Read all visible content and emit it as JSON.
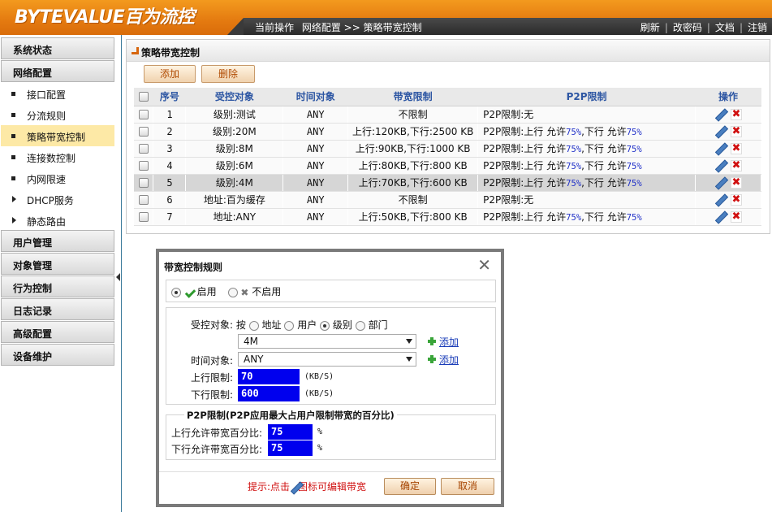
{
  "header": {
    "logo": "BYTEVALUE百为流控",
    "crumb_label": "当前操作",
    "crumb_path": "网络配置 >> 策略带宽控制",
    "links": [
      "刷新",
      "改密码",
      "文档",
      "注销"
    ]
  },
  "sidebar": {
    "groups_top": [
      "系统状态",
      "网络配置"
    ],
    "items": [
      {
        "label": "接口配置",
        "marker": "bullet"
      },
      {
        "label": "分流规则",
        "marker": "bullet"
      },
      {
        "label": "策略带宽控制",
        "marker": "bullet",
        "active": true
      },
      {
        "label": "连接数控制",
        "marker": "bullet"
      },
      {
        "label": "内网限速",
        "marker": "bullet"
      },
      {
        "label": "DHCP服务",
        "marker": "triangle"
      },
      {
        "label": "静态路由",
        "marker": "triangle"
      }
    ],
    "groups_bottom": [
      "用户管理",
      "对象管理",
      "行为控制",
      "日志记录",
      "高级配置",
      "设备维护"
    ]
  },
  "panel": {
    "title": "策略带宽控制",
    "add_label": "添加",
    "delete_label": "删除"
  },
  "table": {
    "headers": [
      "序号",
      "受控对象",
      "时间对象",
      "带宽限制",
      "P2P限制",
      "操作"
    ],
    "rows": [
      {
        "no": "1",
        "object": "级别:测试",
        "time": "ANY",
        "bw": "不限制",
        "p2p_none": "P2P限制:无"
      },
      {
        "no": "2",
        "object": "级别:20M",
        "time": "ANY",
        "bw": "上行:120KB,下行:2500 KB",
        "p2p_up": "75%",
        "p2p_down": "75%"
      },
      {
        "no": "3",
        "object": "级别:8M",
        "time": "ANY",
        "bw": "上行:90KB,下行:1000 KB",
        "p2p_up": "75%",
        "p2p_down": "75%"
      },
      {
        "no": "4",
        "object": "级别:6M",
        "time": "ANY",
        "bw": "上行:80KB,下行:800 KB",
        "p2p_up": "75%",
        "p2p_down": "75%"
      },
      {
        "no": "5",
        "object": "级别:4M",
        "time": "ANY",
        "bw": "上行:70KB,下行:600 KB",
        "p2p_up": "75%",
        "p2p_down": "75%",
        "selected": true
      },
      {
        "no": "6",
        "object": "地址:百为缓存",
        "time": "ANY",
        "bw": "不限制",
        "p2p_none": "P2P限制:无"
      },
      {
        "no": "7",
        "object": "地址:ANY",
        "time": "ANY",
        "bw": "上行:50KB,下行:800 KB",
        "p2p_up": "75%",
        "p2p_down": "75%"
      }
    ],
    "p2p_prefix": "P2P限制:上行 允许",
    "p2p_mid": ",下行 允许"
  },
  "dialog": {
    "title": "带宽控制规则",
    "enable_label": "启用",
    "disable_label": "不启用",
    "object_label": "受控对象:",
    "by_label": "按",
    "options": [
      "地址",
      "用户",
      "级别",
      "部门"
    ],
    "selected_option": "级别",
    "object_value": "4M",
    "add_link": "添加",
    "time_label": "时间对象:",
    "time_value": "ANY",
    "up_label": "上行限制:",
    "up_value": "70",
    "down_label": "下行限制:",
    "down_value": "600",
    "unit": "(KB/S)",
    "p2p_legend": "P2P限制(P2P应用最大占用户限制带宽的百分比)",
    "p2p_up_label": "上行允许带宽百分比:",
    "p2p_up_value": "75",
    "p2p_down_label": "下行允许带宽百分比:",
    "p2p_down_value": "75",
    "percent": "%",
    "hint_prefix": "提示:点击",
    "hint_suffix": "图标可编辑带宽",
    "ok_label": "确定",
    "cancel_label": "取消"
  }
}
